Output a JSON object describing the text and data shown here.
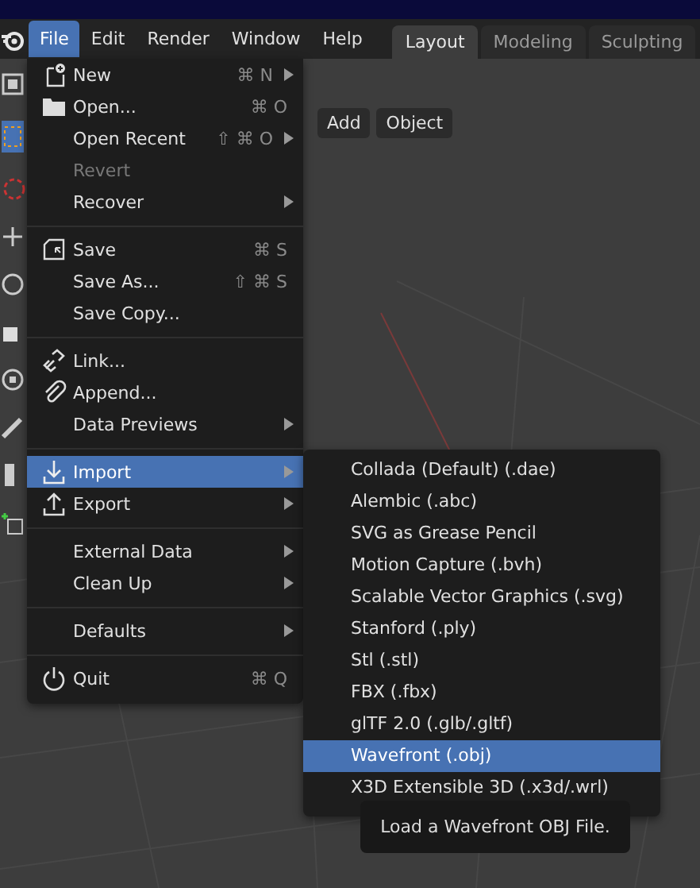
{
  "menubar": {
    "items": [
      {
        "label": "File",
        "selected": true
      },
      {
        "label": "Edit",
        "selected": false
      },
      {
        "label": "Render",
        "selected": false
      },
      {
        "label": "Window",
        "selected": false
      },
      {
        "label": "Help",
        "selected": false
      }
    ]
  },
  "workspace_tabs": [
    {
      "label": "Layout",
      "selected": true
    },
    {
      "label": "Modeling",
      "selected": false
    },
    {
      "label": "Sculpting",
      "selected": false
    }
  ],
  "header_buttons": [
    "Add",
    "Object"
  ],
  "file_menu": {
    "groups": [
      [
        {
          "kind": "new",
          "label": "New",
          "shortcut": "⌘ N",
          "submenu": true,
          "disabled": false,
          "selected": false
        },
        {
          "kind": "open",
          "label": "Open...",
          "shortcut": "⌘ O",
          "submenu": false,
          "disabled": false,
          "selected": false
        },
        {
          "kind": "plain",
          "label": "Open Recent",
          "shortcut": "⇧ ⌘ O",
          "submenu": true,
          "disabled": false,
          "selected": false
        },
        {
          "kind": "plain",
          "label": "Revert",
          "submenu": false,
          "disabled": true,
          "selected": false
        },
        {
          "kind": "plain",
          "label": "Recover",
          "submenu": true,
          "disabled": false,
          "selected": false
        }
      ],
      [
        {
          "kind": "save",
          "label": "Save",
          "shortcut": "⌘ S",
          "submenu": false,
          "disabled": false,
          "selected": false
        },
        {
          "kind": "plain",
          "label": "Save As...",
          "shortcut": "⇧ ⌘ S",
          "submenu": false,
          "disabled": false,
          "selected": false
        },
        {
          "kind": "plain",
          "label": "Save Copy...",
          "submenu": false,
          "disabled": false,
          "selected": false
        }
      ],
      [
        {
          "kind": "link",
          "label": "Link...",
          "submenu": false,
          "disabled": false,
          "selected": false
        },
        {
          "kind": "append",
          "label": "Append...",
          "submenu": false,
          "disabled": false,
          "selected": false
        },
        {
          "kind": "plain",
          "label": "Data Previews",
          "submenu": true,
          "disabled": false,
          "selected": false
        }
      ],
      [
        {
          "kind": "import",
          "label": "Import",
          "submenu": true,
          "disabled": false,
          "selected": true
        },
        {
          "kind": "export",
          "label": "Export",
          "submenu": true,
          "disabled": false,
          "selected": false
        }
      ],
      [
        {
          "kind": "plain",
          "label": "External Data",
          "submenu": true,
          "disabled": false,
          "selected": false
        },
        {
          "kind": "plain",
          "label": "Clean Up",
          "submenu": true,
          "disabled": false,
          "selected": false
        }
      ],
      [
        {
          "kind": "plain",
          "label": "Defaults",
          "submenu": true,
          "disabled": false,
          "selected": false
        }
      ],
      [
        {
          "kind": "quit",
          "label": "Quit",
          "shortcut": "⌘ Q",
          "submenu": false,
          "disabled": false,
          "selected": false
        }
      ]
    ]
  },
  "import_submenu": {
    "items": [
      {
        "label": "Collada (Default) (.dae)",
        "selected": false
      },
      {
        "label": "Alembic (.abc)",
        "selected": false
      },
      {
        "label": "SVG as Grease Pencil",
        "selected": false
      },
      {
        "label": "Motion Capture (.bvh)",
        "selected": false
      },
      {
        "label": "Scalable Vector Graphics (.svg)",
        "selected": false
      },
      {
        "label": "Stanford (.ply)",
        "selected": false
      },
      {
        "label": "Stl (.stl)",
        "selected": false
      },
      {
        "label": "FBX (.fbx)",
        "selected": false
      },
      {
        "label": "glTF 2.0 (.glb/.gltf)",
        "selected": false
      },
      {
        "label": "Wavefront (.obj)",
        "selected": true
      },
      {
        "label": "X3D Extensible 3D (.x3d/.wrl)",
        "selected": false
      }
    ]
  },
  "tooltip": "Load a Wavefront OBJ File."
}
